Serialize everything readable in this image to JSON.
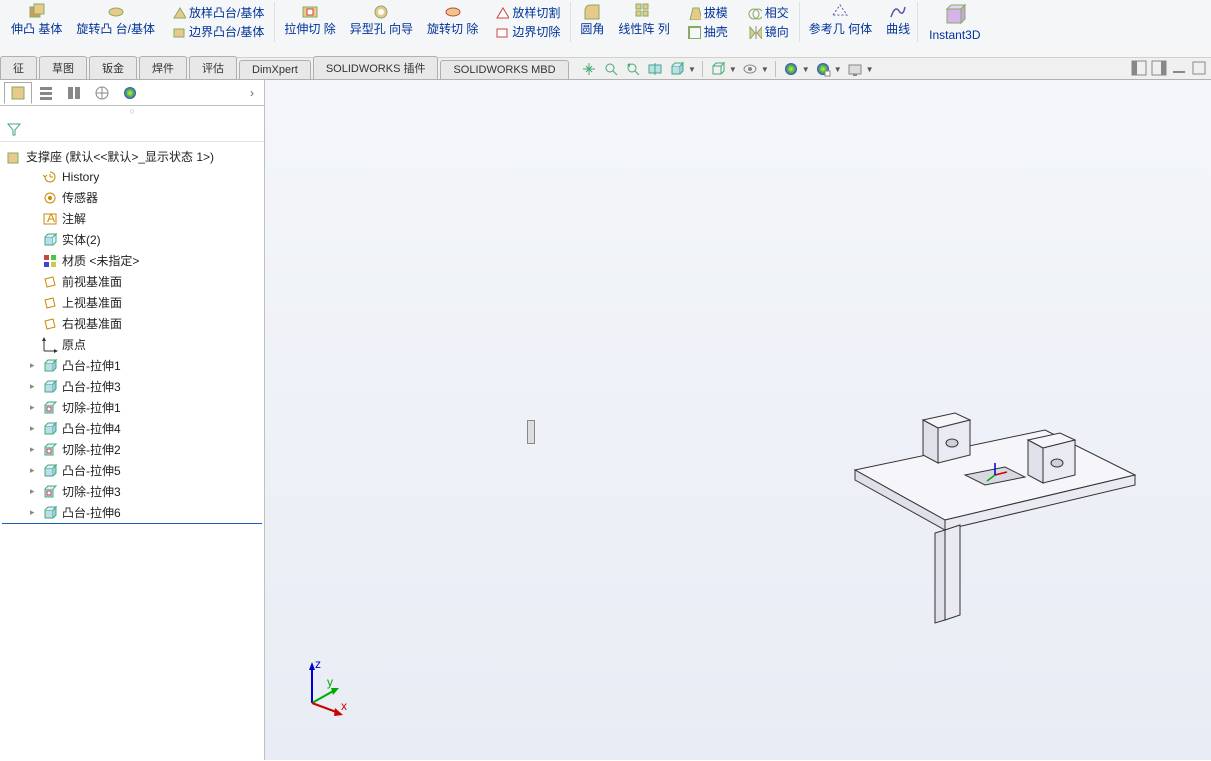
{
  "ribbon": {
    "btn_extrude": "伸凸\n基体",
    "btn_revolve": "旋转凸\n台/基体",
    "sub_loft": "放样凸台/基体",
    "sub_boundary": "边界凸台/基体",
    "btn_extcut": "拉伸切\n除",
    "btn_hole": "异型孔\n向导",
    "btn_revcut": "旋转切\n除",
    "sub_loftcut": "放样切割",
    "sub_boundcut": "边界切除",
    "btn_fillet": "圆角",
    "btn_linpat": "线性阵\n列",
    "sub_draft": "拔模",
    "sub_shell": "抽壳",
    "sub_intersect": "相交",
    "sub_mirror": "镜向",
    "btn_refgeo": "参考几\n何体",
    "btn_curve": "曲线",
    "btn_instant3d": "Instant3D"
  },
  "tabs": [
    "征",
    "草图",
    "钣金",
    "焊件",
    "评估",
    "DimXpert",
    "SOLIDWORKS 插件",
    "SOLIDWORKS MBD"
  ],
  "tree": {
    "root": "支撑座 (默认<<默认>_显示状态 1>)",
    "items": [
      {
        "label": "History",
        "icon": "history"
      },
      {
        "label": "传感器",
        "icon": "sensor"
      },
      {
        "label": "注解",
        "icon": "annotation"
      },
      {
        "label": "实体(2)",
        "icon": "solid"
      },
      {
        "label": "材质 <未指定>",
        "icon": "material"
      },
      {
        "label": "前视基准面",
        "icon": "plane"
      },
      {
        "label": "上视基准面",
        "icon": "plane"
      },
      {
        "label": "右视基准面",
        "icon": "plane"
      },
      {
        "label": "原点",
        "icon": "origin"
      },
      {
        "label": "凸台-拉伸1",
        "icon": "feature",
        "expand": true
      },
      {
        "label": "凸台-拉伸3",
        "icon": "feature",
        "expand": true
      },
      {
        "label": "切除-拉伸1",
        "icon": "cut",
        "expand": true
      },
      {
        "label": "凸台-拉伸4",
        "icon": "feature",
        "expand": true
      },
      {
        "label": "切除-拉伸2",
        "icon": "cut",
        "expand": true
      },
      {
        "label": "凸台-拉伸5",
        "icon": "feature",
        "expand": true
      },
      {
        "label": "切除-拉伸3",
        "icon": "cut",
        "expand": true
      },
      {
        "label": "凸台-拉伸6",
        "icon": "feature",
        "expand": true,
        "last": true
      }
    ]
  },
  "triad": {
    "z": "z",
    "y": "y",
    "x": "x"
  }
}
